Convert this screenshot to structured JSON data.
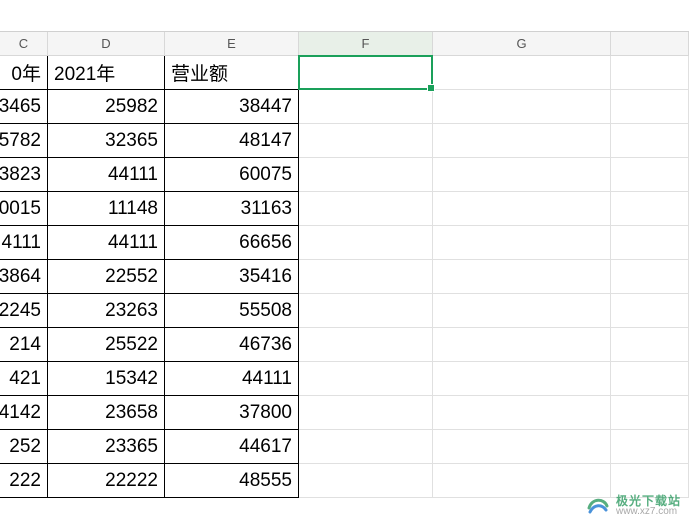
{
  "columns": [
    {
      "label": "C",
      "width": 48
    },
    {
      "label": "D",
      "width": 117
    },
    {
      "label": "E",
      "width": 134
    },
    {
      "label": "F",
      "width": 134
    },
    {
      "label": "G",
      "width": 178
    },
    {
      "label": "",
      "width": 78
    }
  ],
  "selected": {
    "col": 3,
    "row": 0
  },
  "rows": [
    {
      "c": "0年",
      "d": "2021年",
      "e": "营业额",
      "header": true
    },
    {
      "c": "3465",
      "d": "25982",
      "e": "38447"
    },
    {
      "c": "5782",
      "d": "32365",
      "e": "48147"
    },
    {
      "c": "3823",
      "d": "44111",
      "e": "60075"
    },
    {
      "c": "0015",
      "d": "11148",
      "e": "31163"
    },
    {
      "c": "4111",
      "d": "44111",
      "e": "66656"
    },
    {
      "c": "3864",
      "d": "22552",
      "e": "35416"
    },
    {
      "c": "2245",
      "d": "23263",
      "e": "55508"
    },
    {
      "c": "214",
      "d": "25522",
      "e": "46736"
    },
    {
      "c": "421",
      "d": "15342",
      "e": "44111"
    },
    {
      "c": "4142",
      "d": "23658",
      "e": "37800"
    },
    {
      "c": "252",
      "d": "23365",
      "e": "44617"
    },
    {
      "c": "222",
      "d": "22222",
      "e": "48555"
    }
  ],
  "watermark": {
    "title": "极光下载站",
    "url": "www.xz7.com"
  }
}
